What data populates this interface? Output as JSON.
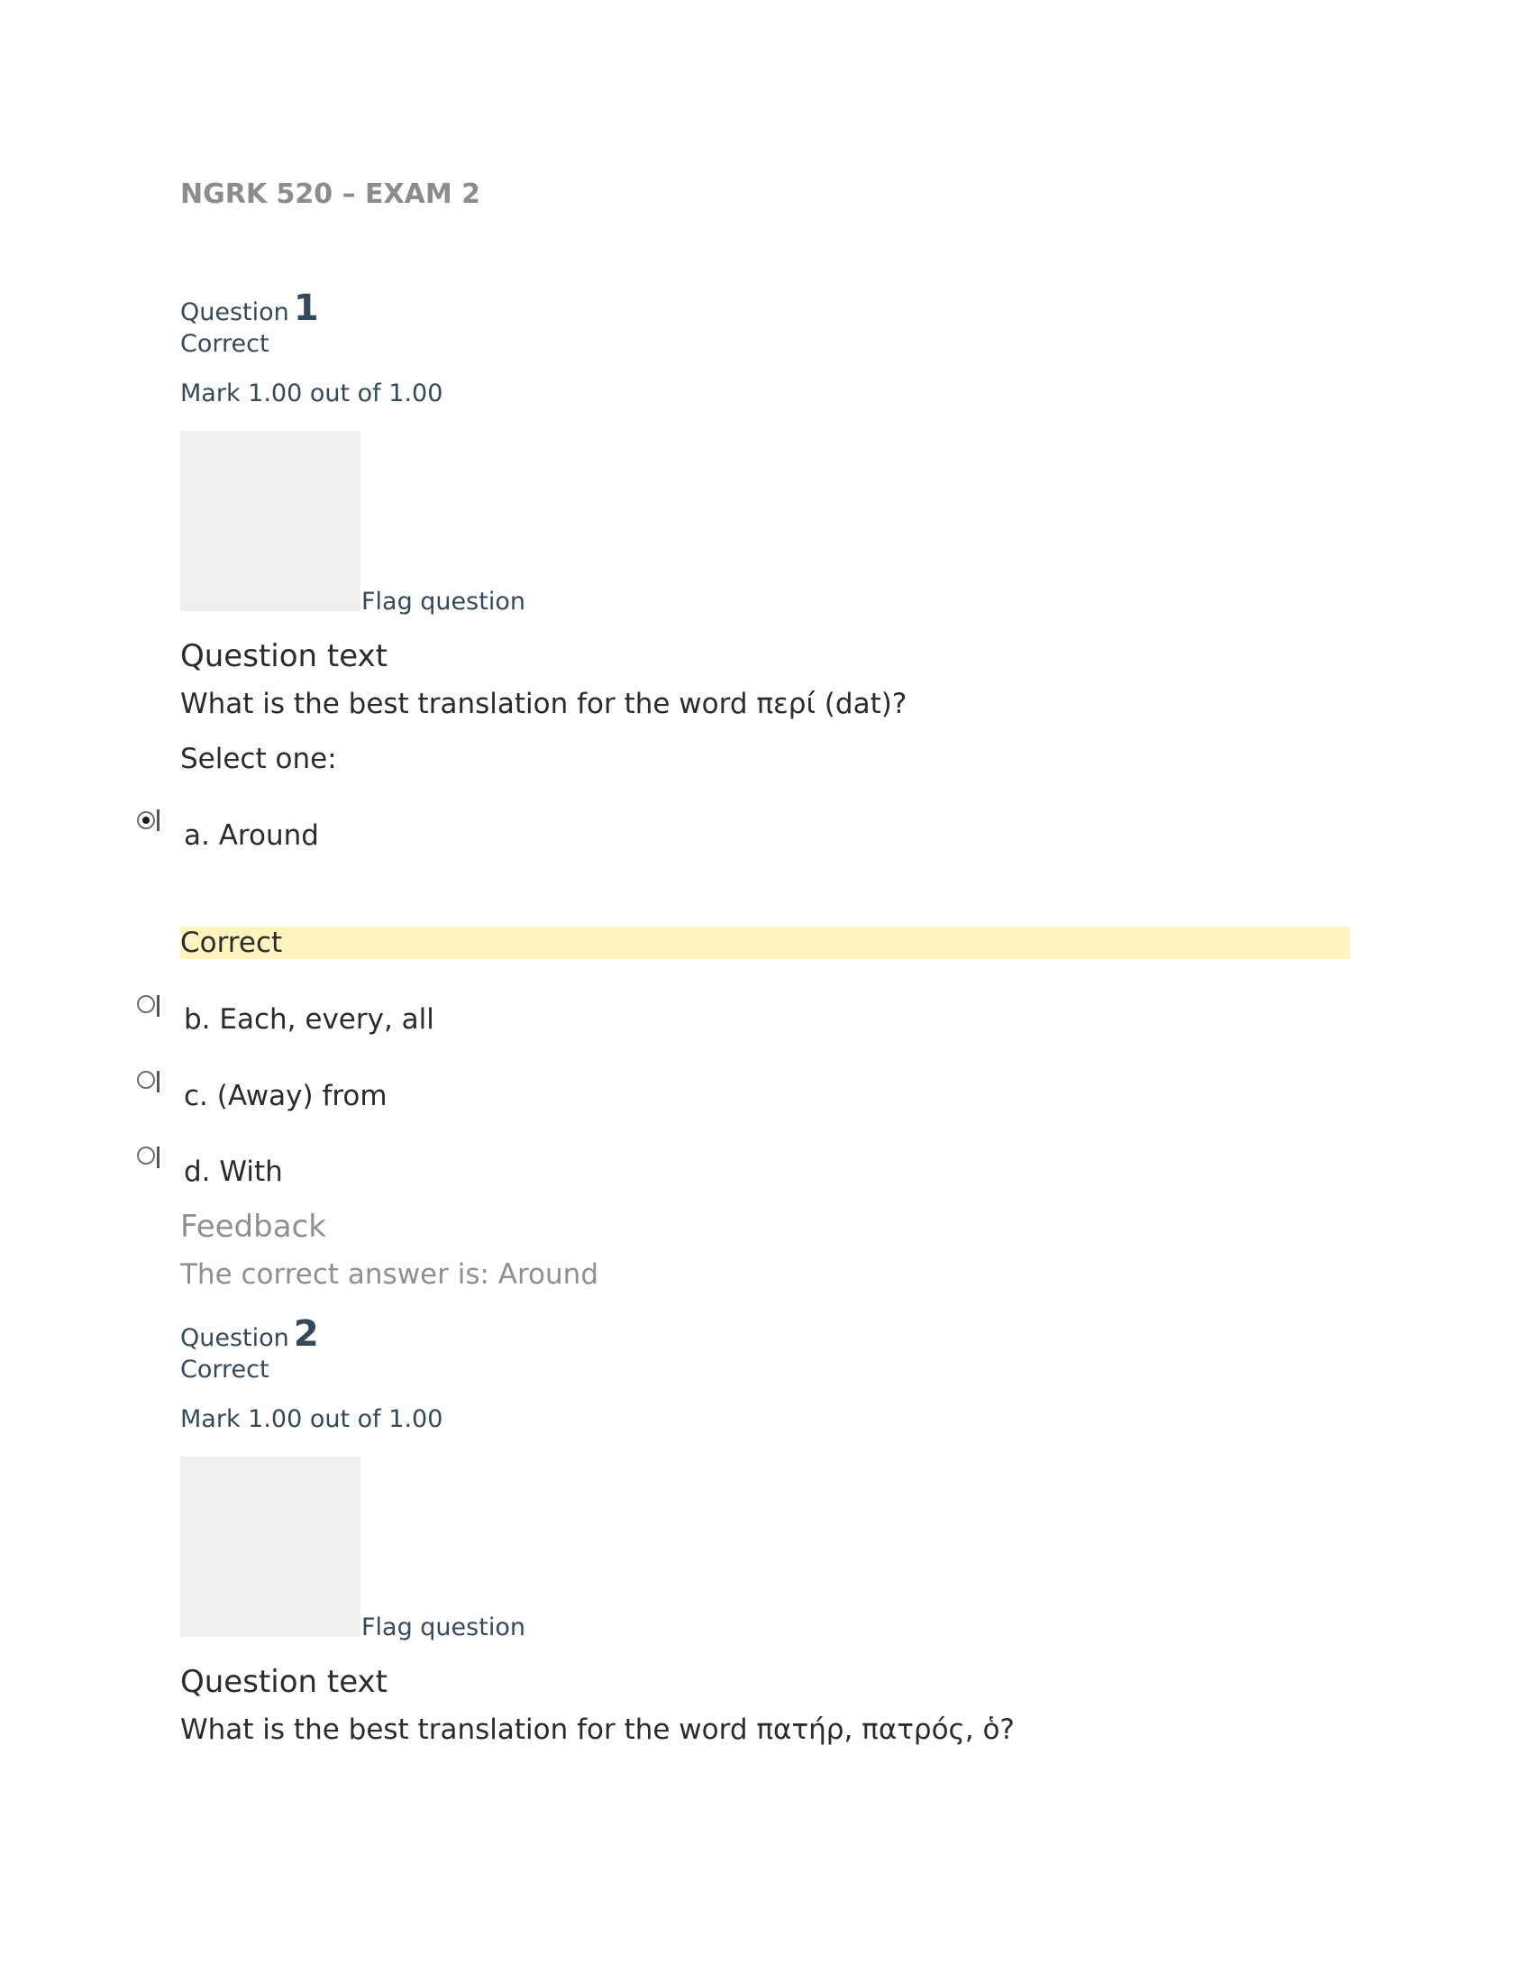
{
  "document": {
    "title": "NGRK 520 – EXAM 2"
  },
  "questions": [
    {
      "label": "Question",
      "number": "1",
      "status": "Correct",
      "mark": "Mark 1.00 out of 1.00",
      "flag_label": "Flag question",
      "text_heading": "Question text",
      "text": "What is the best translation for the word περί (dat)?",
      "select_prompt": "Select one:",
      "answers": [
        {
          "label": "a. Around",
          "selected": true
        },
        {
          "label": "b. Each, every, all",
          "selected": false
        },
        {
          "label": "c. (Away) from",
          "selected": false
        },
        {
          "label": "d. With",
          "selected": false
        }
      ],
      "answer_result": "Correct",
      "feedback_heading": "Feedback",
      "feedback_text": "The correct answer is: Around"
    },
    {
      "label": "Question",
      "number": "2",
      "status": "Correct",
      "mark": "Mark 1.00 out of 1.00",
      "flag_label": "Flag question",
      "text_heading": "Question text",
      "text": "What is the best translation for the word πατήρ, πατρός, ὁ?"
    }
  ],
  "colors": {
    "title": "#8c8c8c",
    "meta_text": "#34495a",
    "body_text": "#2b2b2b",
    "feedback_text": "#8f8f8f",
    "correct_highlight": "#fff3bf",
    "flag_placeholder": "#efefef"
  }
}
